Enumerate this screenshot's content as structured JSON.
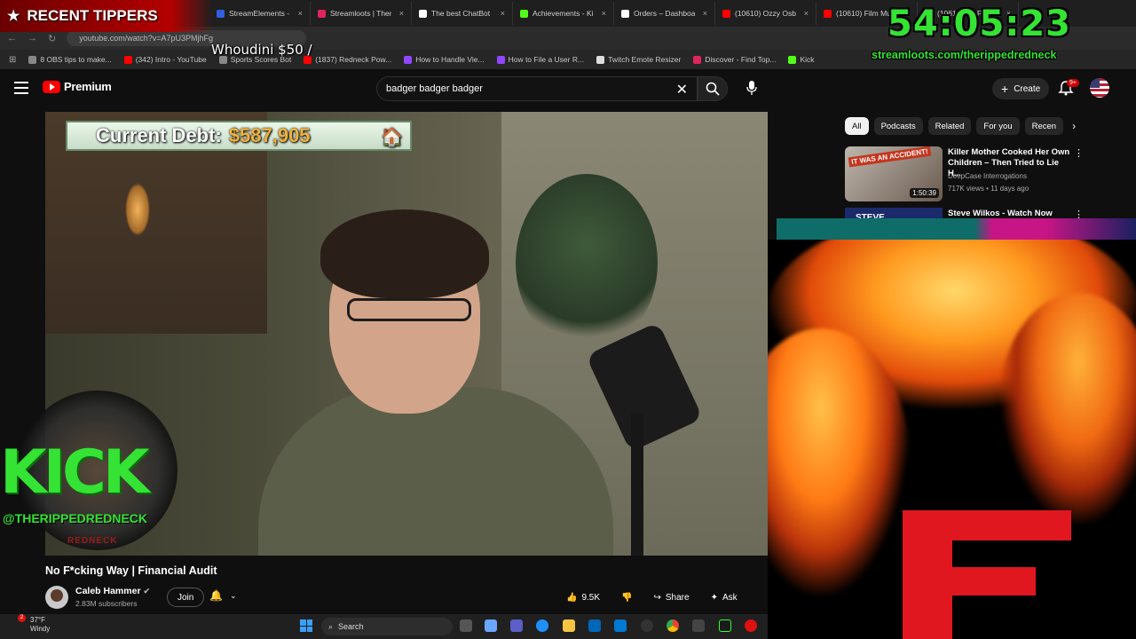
{
  "browser": {
    "tabs": [
      {
        "label": "StreamElements -",
        "color": "#2f5fe0"
      },
      {
        "label": "Streamloots | Ther",
        "color": "#e0245e"
      },
      {
        "label": "The best ChatBot",
        "color": "#ffffff"
      },
      {
        "label": "Achievements - Ki",
        "color": "#53fc18"
      },
      {
        "label": "Orders – Dashboa",
        "color": "#ffffff"
      },
      {
        "label": "(10610) Ozzy Osb",
        "color": "#ff0000"
      },
      {
        "label": "(10610) Film Musi",
        "color": "#ff0000"
      },
      {
        "label": "(10610) No F",
        "color": "#ff0000"
      }
    ],
    "url": "youtube.com/watch?v=A7pU3PMjhFg",
    "bookmarks": [
      {
        "label": "8 OBS tips to make...",
        "color": "#888888"
      },
      {
        "label": "(342) Intro - YouTube",
        "color": "#ff0000"
      },
      {
        "label": "Sports Scores Bot",
        "color": "#888888"
      },
      {
        "label": "(1837) Redneck Pow...",
        "color": "#ff0000"
      },
      {
        "label": "How to Handle Vie...",
        "color": "#9146ff"
      },
      {
        "label": "How to File a User R...",
        "color": "#9146ff"
      },
      {
        "label": "Twitch Emote Resizer",
        "color": "#dddddd"
      },
      {
        "label": "Discover - Find Top...",
        "color": "#e0245e"
      },
      {
        "label": "Kick",
        "color": "#53fc18"
      }
    ]
  },
  "youtube": {
    "logo_text": "Premium",
    "search_value": "badger badger badger",
    "create_label": "Create",
    "notif_badge": "9+"
  },
  "video": {
    "debt_label": "Current Debt:",
    "debt_amount": "$587,905",
    "title": "No F*cking Way | Financial Audit",
    "channel": "Caleb Hammer",
    "subscribers": "2.83M subscribers",
    "join_label": "Join",
    "likes": "9.5K",
    "share_label": "Share",
    "ask_label": "Ask"
  },
  "sidebar": {
    "chips": [
      "All",
      "Podcasts",
      "Related",
      "For you",
      "Recen"
    ],
    "active_chip": "All",
    "recs": [
      {
        "title": "Killer Mother Cooked Her Own Children – Then Tried to Lie H...",
        "channel": "DeepCase Interrogations",
        "meta": "717K views • 11 days ago",
        "duration": "1:50:39",
        "thumb_tag": "IT WAS AN ACCIDENT!"
      },
      {
        "title": "Steve Wilkos - Watch Now",
        "thumb_tag": "STEVE"
      }
    ]
  },
  "overlays": {
    "recent_tippers": "RECENT TIPPERS",
    "ticker": "Whoudini $50 /",
    "timer": "54:05:23",
    "streamloots_url": "streamloots.com/therippedredneck",
    "kick_word": "KICK",
    "kick_handle": "@THERIPPEDREDNECK",
    "kick_sub": "REDNECK"
  },
  "taskbar": {
    "temperature": "37°F",
    "weather": "Windy",
    "weather_badge": "2",
    "search_label": "Search"
  },
  "colors": {
    "youtube_red": "#ff0000",
    "overlay_green": "#34e334",
    "debt_gold": "#f0b23a"
  }
}
